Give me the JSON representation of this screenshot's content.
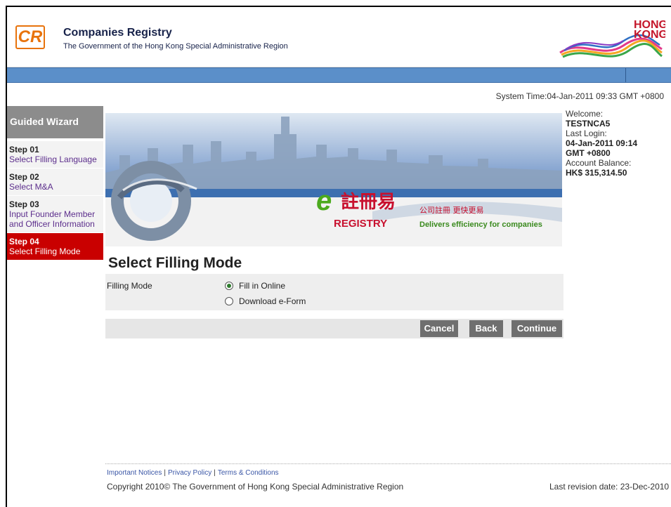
{
  "header": {
    "logo_text": "CR",
    "title": "Companies Registry",
    "subtitle": "The Government of the Hong Kong Special Administrative Region",
    "hk_logo_line1": "HONG",
    "hk_logo_line2": "KONG"
  },
  "system_time": "System Time:04-Jan-2011 09:33 GMT +0800",
  "wizard": {
    "title": "Guided Wizard",
    "steps": [
      {
        "num": "Step 01",
        "label": "Select Filling Language"
      },
      {
        "num": "Step 02",
        "label": "Select M&A"
      },
      {
        "num": "Step 03",
        "label": "Input Founder Member and Officer Information"
      },
      {
        "num": "Step 04",
        "label": "Select Filling Mode"
      }
    ]
  },
  "banner": {
    "chinese_title": "註冊易",
    "registry_word": "REGISTRY",
    "chinese_slogan": "公司註冊 更快更易",
    "english_slogan": "Delivers efficiency for companies"
  },
  "welcome": {
    "welcome_label": "Welcome:",
    "user": "TESTNCA5",
    "last_login_label": "Last Login:",
    "last_login_date": "04-Jan-2011 09:14",
    "last_login_tz": "GMT +0800",
    "balance_label": "Account Balance:",
    "balance": "HK$ 315,314.50"
  },
  "page_title": "Select Filling Mode",
  "filling_mode": {
    "label": "Filling Mode",
    "options": [
      {
        "label": "Fill in Online",
        "selected": true
      },
      {
        "label": "Download e-Form",
        "selected": false
      }
    ]
  },
  "buttons": {
    "cancel": "Cancel",
    "back": "Back",
    "continue": "Continue"
  },
  "footer": {
    "links": [
      "Important Notices",
      "Privacy Policy",
      "Terms & Conditions"
    ],
    "separator": "|",
    "copyright": "Copyright 2010© The Government of Hong Kong Special Administrative Region",
    "revision": "Last revision date: 23-Dec-2010"
  },
  "colors": {
    "accent_blue": "#5b8fc9",
    "active_step": "#c90000",
    "button": "#6f6f6f",
    "logo_orange": "#e8730c"
  }
}
